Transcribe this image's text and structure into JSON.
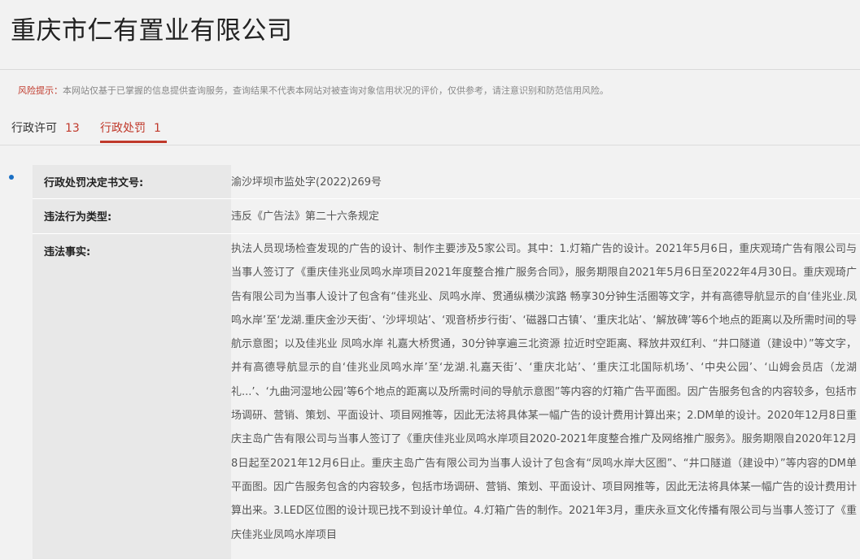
{
  "company": {
    "name": "重庆市仁有置业有限公司"
  },
  "risk_notice": {
    "label": "风险提示：",
    "text": "本网站仅基于已掌握的信息提供查询服务，查询结果不代表本网站对被查询对象信用状况的评价，仅供参考，请注意识别和防范信用风险。"
  },
  "tabs": [
    {
      "label": "行政许可",
      "count": "13",
      "active": false
    },
    {
      "label": "行政处罚",
      "count": "1",
      "active": true
    }
  ],
  "record": {
    "doc_no_label": "行政处罚决定书文号:",
    "doc_no_value": "渝沙坪坝市监处字(2022)269号",
    "type_label": "违法行为类型:",
    "type_value": "违反《广告法》第二十六条规定",
    "facts_label": "违法事实:",
    "facts_value": "执法人员现场检查发现的广告的设计、制作主要涉及5家公司。其中：1.灯箱广告的设计。2021年5月6日，重庆观琦广告有限公司与当事人签订了《重庆佳兆业凤鸣水岸项目2021年度整合推广服务合同》，服务期限自2021年5月6日至2022年4月30日。重庆观琦广告有限公司为当事人设计了包含有“佳兆业、凤鸣水岸、贯通纵横沙滨路 畅享30分钟生活圈等文字，并有高德导航显示的自‘佳兆业.凤鸣水岸’至‘龙湖.重庆金沙天街’、‘沙坪坝站’、‘观音桥步行街’、‘磁器口古镇’、‘重庆北站’、‘解放碑’等6个地点的距离以及所需时间的导航示意图；以及佳兆业 凤鸣水岸 礼嘉大桥贯通，30分钟享遍三北资源 拉近时空距离、释放井双红利、“井口隧道（建设中）”等文字，并有高德导航显示的自‘佳兆业凤鸣水岸’至‘龙湖.礼嘉天街’、‘重庆北站’、‘重庆江北国际机场’、‘中央公园’、‘山姆会员店（龙湖礼...’、‘九曲河湿地公园’等6个地点的距离以及所需时间的导航示意图”等内容的灯箱广告平面图。因广告服务包含的内容较多，包括市场调研、营销、策划、平面设计、项目网推等，因此无法将具体某一幅广告的设计费用计算出来；2.DM单的设计。2020年12月8日重庆主岛广告有限公司与当事人签订了《重庆佳兆业凤鸣水岸项目2020-2021年度整合推广及网络推广服务》。服务期限自2020年12月8日起至2021年12月6日止。重庆主岛广告有限公司为当事人设计了包含有“凤鸣水岸大区图”、“井口隧道（建设中）”等内容的DM单平面图。因广告服务包含的内容较多，包括市场调研、营销、策划、平面设计、项目网推等，因此无法将具体某一幅广告的设计费用计算出来。3.LED区位图的设计现已找不到设计单位。4.灯箱广告的制作。2021年3月，重庆永亘文化传播有限公司与当事人签订了《重庆佳兆业凤鸣水岸项目"
  }
}
